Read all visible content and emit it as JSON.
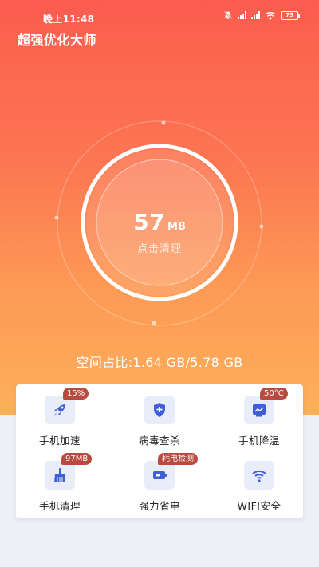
{
  "status_bar": {
    "time": "晚上11:48",
    "battery": "75",
    "icons": [
      "alarm-off-icon",
      "signal-icon",
      "signal-icon",
      "wifi-icon",
      "battery-icon"
    ]
  },
  "app": {
    "title": "超强优化大师"
  },
  "gauge": {
    "value": "57",
    "unit": "MB",
    "action": "点击清理"
  },
  "storage": {
    "text": "空间占比:1.64 GB/5.78 GB"
  },
  "colors": {
    "gradient_top": "#fb5c4e",
    "gradient_bottom": "#fdb05a",
    "icon_blue": "#3f5fd6",
    "icon_bg": "#e9ecf9",
    "badge": "#b84a3f"
  },
  "tools": [
    {
      "label": "手机加速",
      "badge": "15%",
      "icon": "rocket-icon"
    },
    {
      "label": "病毒查杀",
      "badge": "",
      "icon": "shield-plus-icon"
    },
    {
      "label": "手机降温",
      "badge": "50°C",
      "icon": "chart-monitor-icon"
    },
    {
      "label": "手机清理",
      "badge": "97MB",
      "icon": "broom-icon"
    },
    {
      "label": "强力省电",
      "badge": "耗电检测",
      "icon": "battery-saver-icon"
    },
    {
      "label": "WIFI安全",
      "badge": "",
      "icon": "wifi-icon"
    }
  ]
}
